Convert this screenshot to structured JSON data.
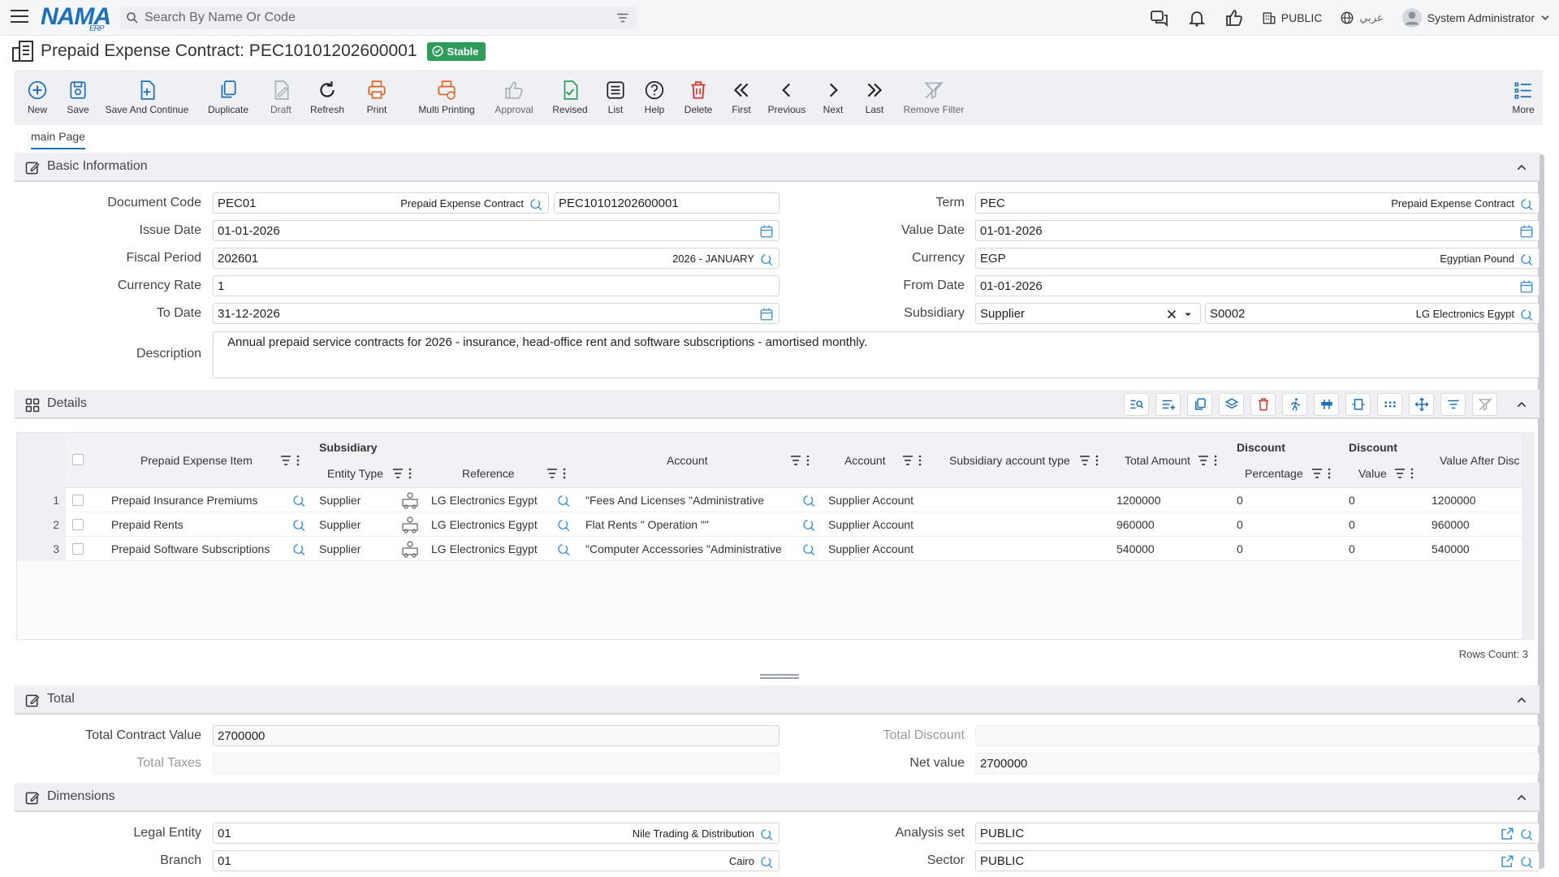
{
  "header": {
    "logo": "NAMA",
    "logo_sub": "ERP",
    "search_placeholder": "Search By Name Or Code",
    "org": "PUBLIC",
    "language": "عربي",
    "user": "System Administrator"
  },
  "title": {
    "text": "Prepaid Expense Contract: PEC10101202600001",
    "status": "Stable"
  },
  "toolbar": [
    {
      "label": "New",
      "icon": "plus-circle-icon"
    },
    {
      "label": "Save",
      "icon": "save-icon"
    },
    {
      "label": "Save And Continue",
      "icon": "save-continue-icon"
    },
    {
      "label": "Duplicate",
      "icon": "duplicate-icon"
    },
    {
      "label": "Draft",
      "icon": "draft-icon"
    },
    {
      "label": "Refresh",
      "icon": "refresh-icon"
    },
    {
      "label": "Print",
      "icon": "print-icon"
    },
    {
      "label": "Multi Printing",
      "icon": "multi-print-icon"
    },
    {
      "label": "Approval",
      "icon": "thumbs-up-icon"
    },
    {
      "label": "Revised",
      "icon": "revised-icon"
    },
    {
      "label": "List",
      "icon": "list-icon"
    },
    {
      "label": "Help",
      "icon": "help-icon"
    },
    {
      "label": "Delete",
      "icon": "trash-icon"
    },
    {
      "label": "First",
      "icon": "first-icon"
    },
    {
      "label": "Previous",
      "icon": "previous-icon"
    },
    {
      "label": "Next",
      "icon": "next-icon"
    },
    {
      "label": "Last",
      "icon": "last-icon"
    },
    {
      "label": "Remove Filter",
      "icon": "remove-filter-icon"
    },
    {
      "label": "More",
      "icon": "more-icon"
    }
  ],
  "tabs": {
    "main": "main Page"
  },
  "basic": {
    "title": "Basic Information",
    "document_code_label": "Document Code",
    "document_code": "PEC01",
    "document_code_name": "Prepaid Expense Contract",
    "document_number": "PEC10101202600001",
    "issue_date_label": "Issue Date",
    "issue_date": "01-01-2026",
    "fiscal_period_label": "Fiscal Period",
    "fiscal_period": "202601",
    "fiscal_period_name": "2026 - JANUARY",
    "currency_rate_label": "Currency Rate",
    "currency_rate": "1",
    "to_date_label": "To Date",
    "to_date": "31-12-2026",
    "description_label": "Description",
    "description": "Annual prepaid service contracts for 2026 - insurance, head-office rent and software subscriptions - amortised monthly.",
    "term_label": "Term",
    "term": "PEC",
    "term_name": "Prepaid Expense Contract",
    "value_date_label": "Value Date",
    "value_date": "01-01-2026",
    "currency_label": "Currency",
    "currency": "EGP",
    "currency_name": "Egyptian Pound",
    "from_date_label": "From Date",
    "from_date": "01-01-2026",
    "subsidiary_label": "Subsidiary",
    "subsidiary_type": "Supplier",
    "subsidiary_code": "S0002",
    "subsidiary_name": "LG Electronics Egypt"
  },
  "details": {
    "title": "Details",
    "headers": {
      "item": "Prepaid Expense Item",
      "subsidiary_group": "Subsidiary",
      "entity_type": "Entity Type",
      "reference": "Reference",
      "account": "Account",
      "account2": "Account",
      "sub_acc_type": "Subsidiary account type",
      "total_amount": "Total Amount",
      "discount_group1": "Discount",
      "percentage": "Percentage",
      "discount_group2": "Discount",
      "value": "Value",
      "value_after": "Value After Disc"
    },
    "rows": [
      {
        "n": "1",
        "item": "Prepaid Insurance Premiums",
        "entity": "Supplier",
        "ref": "LG Electronics Egypt",
        "account": "\"Fees And Licenses \"Administrative",
        "account2": "Supplier Account",
        "total": "1200000",
        "pct": "0",
        "val": "0",
        "after": "1200000"
      },
      {
        "n": "2",
        "item": "Prepaid Rents",
        "entity": "Supplier",
        "ref": "LG Electronics Egypt",
        "account": "Flat Rents \" Operation \"\"",
        "account2": "Supplier Account",
        "total": "960000",
        "pct": "0",
        "val": "0",
        "after": "960000"
      },
      {
        "n": "3",
        "item": "Prepaid Software Subscriptions",
        "entity": "Supplier",
        "ref": "LG Electronics Egypt",
        "account": "\"Computer Accessories \"Administrative",
        "account2": "Supplier Account",
        "total": "540000",
        "pct": "0",
        "val": "0",
        "after": "540000"
      }
    ],
    "rows_count": "Rows Count: 3"
  },
  "total": {
    "title": "Total",
    "contract_value_label": "Total Contract Value",
    "contract_value": "2700000",
    "taxes_label": "Total Taxes",
    "taxes": "",
    "discount_label": "Total Discount",
    "discount": "",
    "net_label": "Net value",
    "net": "2700000"
  },
  "dimensions": {
    "title": "Dimensions",
    "legal_entity_label": "Legal Entity",
    "legal_entity": "01",
    "legal_entity_name": "Nile Trading & Distribution",
    "branch_label": "Branch",
    "branch": "01",
    "branch_name": "Cairo",
    "analysis_set_label": "Analysis set",
    "analysis_set": "PUBLIC",
    "sector_label": "Sector",
    "sector": "PUBLIC"
  },
  "colors": {
    "accent": "#1c6fb8",
    "stable": "#2e9c5a",
    "delete": "#d9342b",
    "print": "#e0662b"
  }
}
